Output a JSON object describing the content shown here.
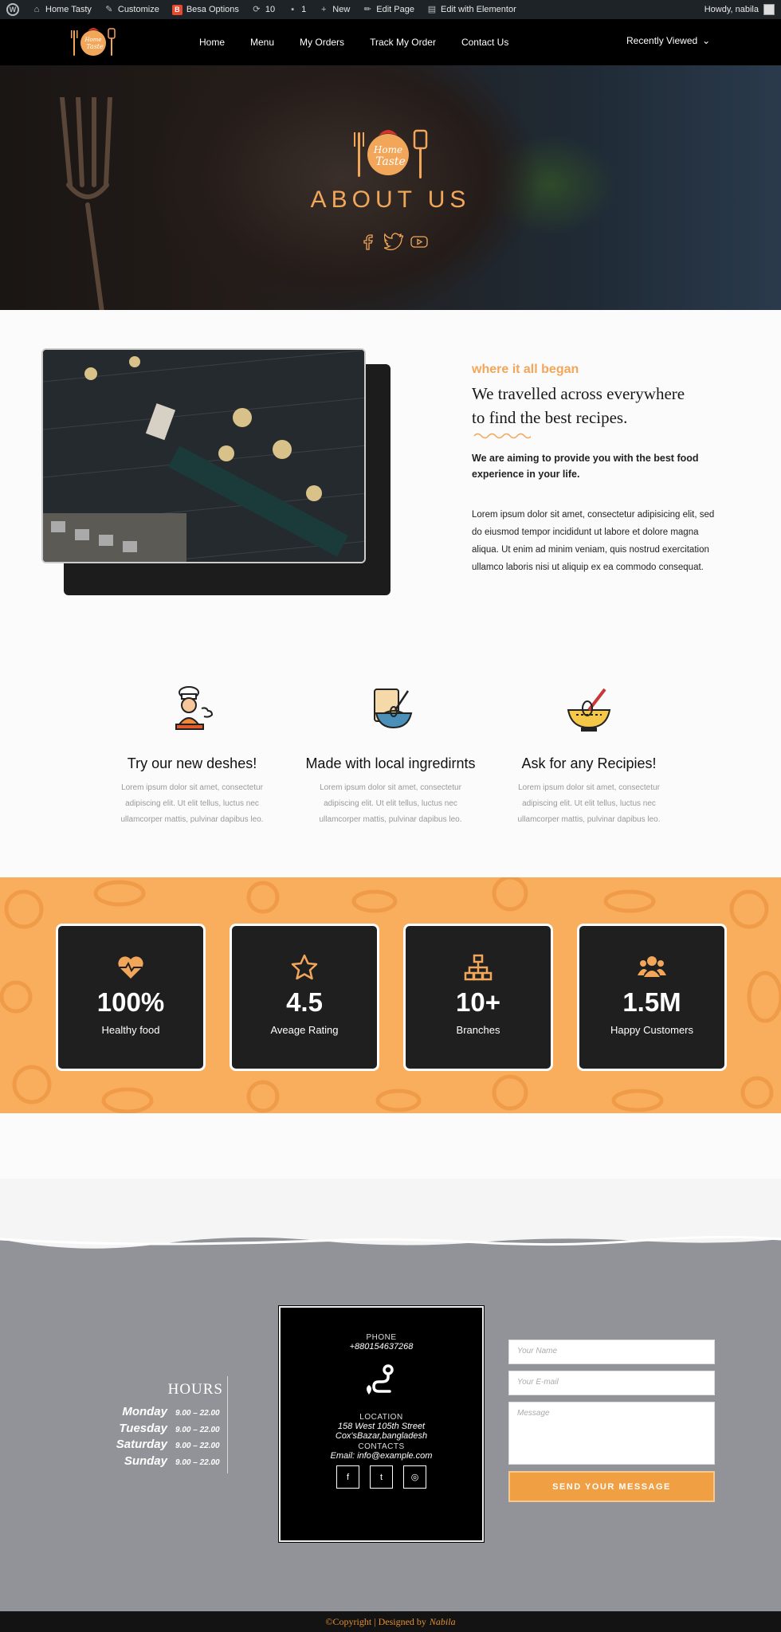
{
  "admin_bar": {
    "site_name": "Home Tasty",
    "customize": "Customize",
    "besa_options": "Besa Options",
    "updates_count": "10",
    "comments_count": "1",
    "new": "New",
    "edit_page": "Edit Page",
    "edit_with_elementor": "Edit with Elementor",
    "howdy": "Howdy, nabila"
  },
  "header": {
    "nav": [
      "Home",
      "Menu",
      "My Orders",
      "Track My Order",
      "Contact Us"
    ],
    "recently_viewed": "Recently Viewed",
    "logo_text_1": "Home",
    "logo_text_2": "Taste"
  },
  "hero": {
    "title": "ABOUT US",
    "socials": [
      "facebook-icon",
      "twitter-icon",
      "youtube-icon"
    ]
  },
  "about": {
    "eyebrow": "where it all began",
    "headline_1": "We travelled across everywhere",
    "headline_2": "to find the best recipes.",
    "lead": "We are aiming to provide you with the best food experience in your life.",
    "body": "Lorem ipsum dolor sit amet, consectetur adipisicing elit, sed do eiusmod tempor incididunt ut labore et dolore magna aliqua. Ut enim ad minim veniam, quis nostrud exercitation ullamco laboris nisi ut aliquip ex ea commodo consequat."
  },
  "features": [
    {
      "icon": "chef-icon",
      "title": "Try our new deshes!",
      "text": "Lorem ipsum dolor sit amet, consectetur adipiscing elit. Ut elit tellus, luctus nec ullamcorper mattis, pulvinar dapibus leo."
    },
    {
      "icon": "mixing-bowl-icon",
      "title": "Made with local ingredirnts",
      "text": "Lorem ipsum dolor sit amet, consectetur adipiscing elit. Ut elit tellus, luctus nec ullamcorper mattis, pulvinar dapibus leo."
    },
    {
      "icon": "whisk-bowl-icon",
      "title": "Ask for any Recipies!",
      "text": "Lorem ipsum dolor sit amet, consectetur adipiscing elit. Ut elit tellus, luctus nec ullamcorper mattis, pulvinar dapibus leo."
    }
  ],
  "stats": [
    {
      "icon": "heartbeat-icon",
      "value": "100%",
      "label": "Healthy food"
    },
    {
      "icon": "star-icon",
      "value": "4.5",
      "label": "Aveage Rating"
    },
    {
      "icon": "sitemap-icon",
      "value": "10+",
      "label": "Branches"
    },
    {
      "icon": "users-icon",
      "value": "1.5M",
      "label": "Happy Customers"
    }
  ],
  "hours": {
    "title": "HOURS",
    "rows": [
      {
        "day": "Monday",
        "time": "9.00 – 22.00"
      },
      {
        "day": "Tuesday",
        "time": "9.00 – 22.00"
      },
      {
        "day": "Saturday",
        "time": "9.00 – 22.00"
      },
      {
        "day": "Sunday",
        "time": "9.00 – 22.00"
      }
    ]
  },
  "contact": {
    "phone_label": "PHONE",
    "phone": "+8801546372​68",
    "location_label": "LOCATION",
    "address_1": "158 West 105th Street",
    "address_2": "Cox'sBazar,bangladesh",
    "contacts_label": "CONTACTS",
    "email": "Email: info@example.com",
    "socials": [
      "facebook-icon",
      "twitter-icon",
      "whatsapp-icon"
    ]
  },
  "form": {
    "name_placeholder": "Your Name",
    "email_placeholder": "Your E-mail",
    "message_placeholder": "Message",
    "submit": "SEND YOUR MESSAGE"
  },
  "footer": {
    "copyright": "©Copyright | Designed by",
    "designer": "Nabila"
  },
  "colors": {
    "accent": "#f2a65a",
    "stats_bg": "#f9ae5d",
    "footer_bg": "#929398",
    "button": "#f0a043"
  }
}
